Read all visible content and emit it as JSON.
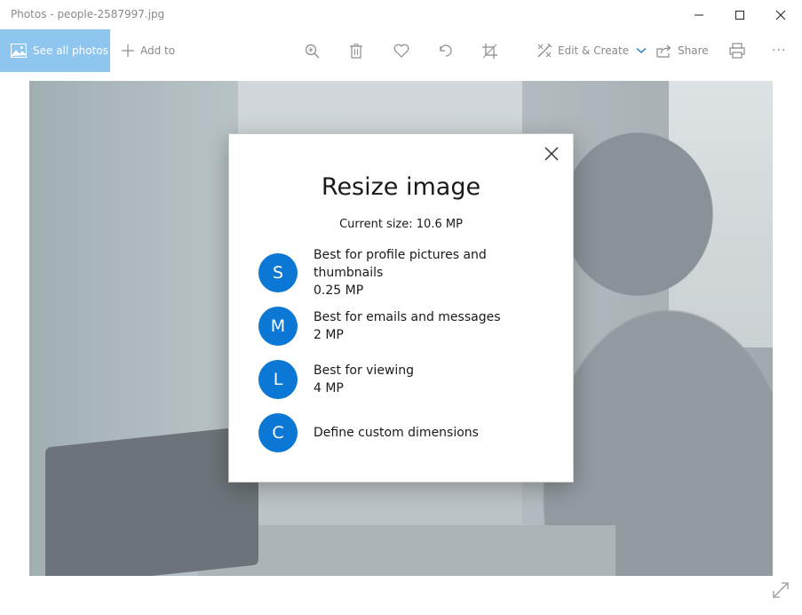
{
  "window": {
    "title": "Photos - people-2587997.jpg"
  },
  "toolbar": {
    "see_all_label": "See all photos",
    "add_to_label": "Add to",
    "edit_create_label": "Edit & Create",
    "share_label": "Share",
    "more_label": "···"
  },
  "dialog": {
    "title": "Resize image",
    "current_size": "Current size: 10.6 MP",
    "options": [
      {
        "letter": "S",
        "label": "Best for profile pictures and thumbnails",
        "size": "0.25 MP"
      },
      {
        "letter": "M",
        "label": "Best for emails and messages",
        "size": "2 MP"
      },
      {
        "letter": "L",
        "label": "Best for viewing",
        "size": "4 MP"
      },
      {
        "letter": "C",
        "label": "Define custom dimensions",
        "size": ""
      }
    ]
  },
  "colors": {
    "accent": "#0a78d4",
    "see_all_bg": "#8ec6ef"
  },
  "icons": {
    "minimize": "minimize-icon",
    "maximize": "maximize-icon",
    "close": "close-icon",
    "zoom": "zoom-icon",
    "delete": "trash-icon",
    "favorite": "heart-icon",
    "rotate": "rotate-icon",
    "crop": "crop-icon",
    "edit": "edit-create-icon",
    "share": "share-icon",
    "print": "print-icon",
    "expand": "expand-icon"
  }
}
